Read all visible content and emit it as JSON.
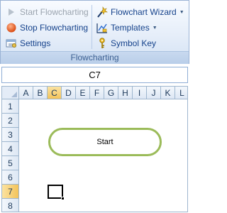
{
  "ribbon": {
    "left": [
      {
        "label": "Start Flowcharting",
        "icon": "play-icon",
        "disabled": true
      },
      {
        "label": "Stop Flowcharting",
        "icon": "stop-icon",
        "disabled": false
      },
      {
        "label": "Settings",
        "icon": "settings-icon",
        "disabled": false
      }
    ],
    "right": [
      {
        "label": "Flowchart Wizard",
        "icon": "wizard-icon",
        "dropdown": true
      },
      {
        "label": "Templates",
        "icon": "templates-icon",
        "dropdown": true
      },
      {
        "label": "Symbol Key",
        "icon": "key-icon",
        "dropdown": false
      }
    ],
    "group_label": "Flowcharting"
  },
  "namebox": {
    "value": "C7"
  },
  "sheet": {
    "columns": [
      "A",
      "B",
      "C",
      "D",
      "E",
      "F",
      "G",
      "H",
      "I",
      "J",
      "K",
      "L"
    ],
    "rows": [
      "1",
      "2",
      "3",
      "4",
      "5",
      "6",
      "7",
      "8"
    ],
    "selected_column": "C",
    "selected_row": "7",
    "shape_text": "Start"
  },
  "colors": {
    "accent": "#9bbb59",
    "ribbon_text": "#15428b"
  }
}
